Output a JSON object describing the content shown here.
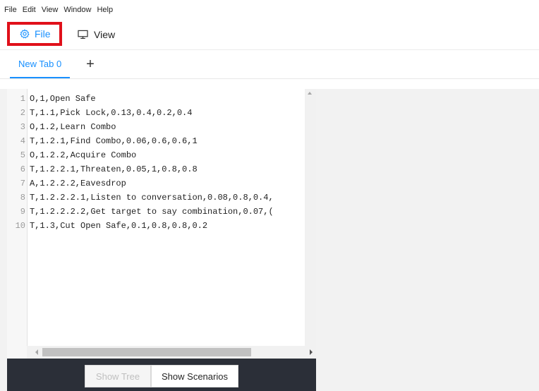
{
  "menu": [
    "File",
    "Edit",
    "View",
    "Window",
    "Help"
  ],
  "toolbar": {
    "file_label": "File",
    "view_label": "View",
    "file_icon": "gear-icon",
    "view_icon": "monitor-icon",
    "accent_color": "#1890ff",
    "highlight_color": "#e0101a"
  },
  "tabs": {
    "active_label": "New Tab 0",
    "add_label": "+"
  },
  "editor": {
    "lines": [
      {
        "n": "1",
        "text": "O,1,Open Safe"
      },
      {
        "n": "2",
        "text": "T,1.1,Pick Lock,0.13,0.4,0.2,0.4"
      },
      {
        "n": "3",
        "text": "O,1.2,Learn Combo"
      },
      {
        "n": "4",
        "text": "T,1.2.1,Find Combo,0.06,0.6,0.6,1"
      },
      {
        "n": "5",
        "text": "O,1.2.2,Acquire Combo"
      },
      {
        "n": "6",
        "text": "T,1.2.2.1,Threaten,0.05,1,0.8,0.8"
      },
      {
        "n": "7",
        "text": "A,1.2.2.2,Eavesdrop"
      },
      {
        "n": "8",
        "text": "T,1.2.2.2.1,Listen to conversation,0.08,0.8,0.4,"
      },
      {
        "n": "9",
        "text": "T,1.2.2.2.2,Get target to say combination,0.07,("
      },
      {
        "n": "10",
        "text": "T,1.3,Cut Open Safe,0.1,0.8,0.8,0.2"
      }
    ]
  },
  "footer": {
    "show_tree_label": "Show Tree",
    "show_scenarios_label": "Show Scenarios"
  }
}
